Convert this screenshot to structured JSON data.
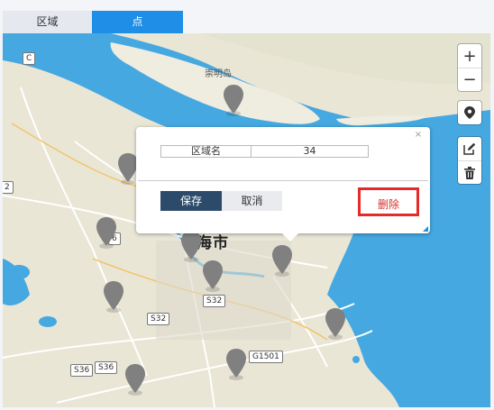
{
  "tabs": [
    {
      "label": "区域",
      "active": false
    },
    {
      "label": "点",
      "active": true
    }
  ],
  "map": {
    "labels": {
      "island": "崇明岛",
      "city": "海市",
      "c2": "2",
      "c3": "6",
      "cc": "C"
    },
    "road_shields": [
      "S32",
      "S32",
      "G1501",
      "S36",
      "S36"
    ],
    "colors": {
      "water": "#46a8e0",
      "land": "#e9e6d6",
      "pin": "#808080"
    }
  },
  "controls": {
    "zoom_in": "+",
    "zoom_out": "−"
  },
  "popup": {
    "attr_key": "区域名",
    "attr_value": "34",
    "save_label": "保存",
    "cancel_label": "取消",
    "delete_label": "删除"
  },
  "colors": {
    "accent": "#1e8ee6",
    "save": "#2c4b6b",
    "delete": "#d9302b"
  }
}
